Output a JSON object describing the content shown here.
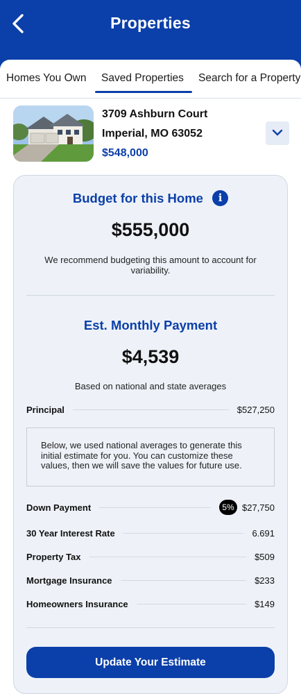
{
  "header": {
    "title": "Properties",
    "back_icon": "chevron-left-icon"
  },
  "tabs": [
    {
      "label": "Homes You Own",
      "selected": false
    },
    {
      "label": "Saved Properties",
      "selected": true
    },
    {
      "label": "Search for a Property",
      "selected": false
    }
  ],
  "property": {
    "address_line1": "3709 Ashburn Court",
    "address_line2": "Imperial, MO 63052",
    "price": "$548,000",
    "expand_icon": "chevron-down-icon"
  },
  "budget": {
    "title": "Budget for this Home",
    "amount": "$555,000",
    "note": "We recommend budgeting this amount to account for variability.",
    "info_icon": "info-icon"
  },
  "payment": {
    "title": "Est. Monthly Payment",
    "amount": "$4,539",
    "note": "Based on national and state averages",
    "principal_label": "Principal",
    "principal_value": "$527,250",
    "info_box": "Below, we used national averages to generate this initial estimate for you. You can customize these values, then we will save the values for future use.",
    "rows": [
      {
        "label": "Down Payment",
        "badge": "5%",
        "value": "$27,750"
      },
      {
        "label": "30 Year Interest Rate",
        "value": "6.691"
      },
      {
        "label": "Property Tax",
        "value": "$509"
      },
      {
        "label": "Mortgage Insurance",
        "value": "$233"
      },
      {
        "label": "Homeowners Insurance",
        "value": "$149"
      }
    ]
  },
  "actions": {
    "update_label": "Update Your Estimate"
  },
  "colors": {
    "brand_blue": "#0b3fa9",
    "card_bg": "#eef2f8"
  }
}
